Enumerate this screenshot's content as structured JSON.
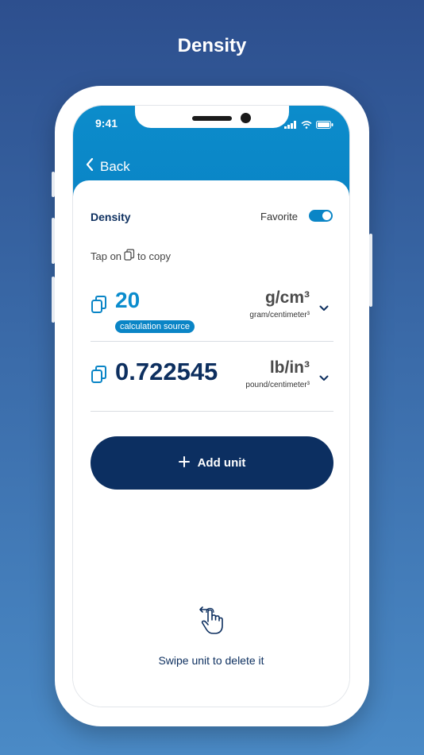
{
  "page_title": "Density",
  "status_bar": {
    "time": "9:41"
  },
  "nav": {
    "back_label": "Back"
  },
  "card": {
    "title": "Density",
    "favorite_label": "Favorite",
    "favorite_on": true,
    "hint_prefix": "Tap on",
    "hint_suffix": "to copy"
  },
  "units": [
    {
      "value": "20",
      "badge": "calculation source",
      "symbol": "g/cm³",
      "name": "gram/centimeter³"
    },
    {
      "value": "0.722545",
      "symbol": "lb/in³",
      "name": "pound/centimeter³"
    }
  ],
  "add_unit_label": "Add unit",
  "swipe_hint": "Swipe unit to delete it",
  "colors": {
    "accent": "#0a85c6",
    "navy": "#0c2f61",
    "background_top": "#2d4f8e",
    "background_bottom": "#4a8ac6"
  }
}
